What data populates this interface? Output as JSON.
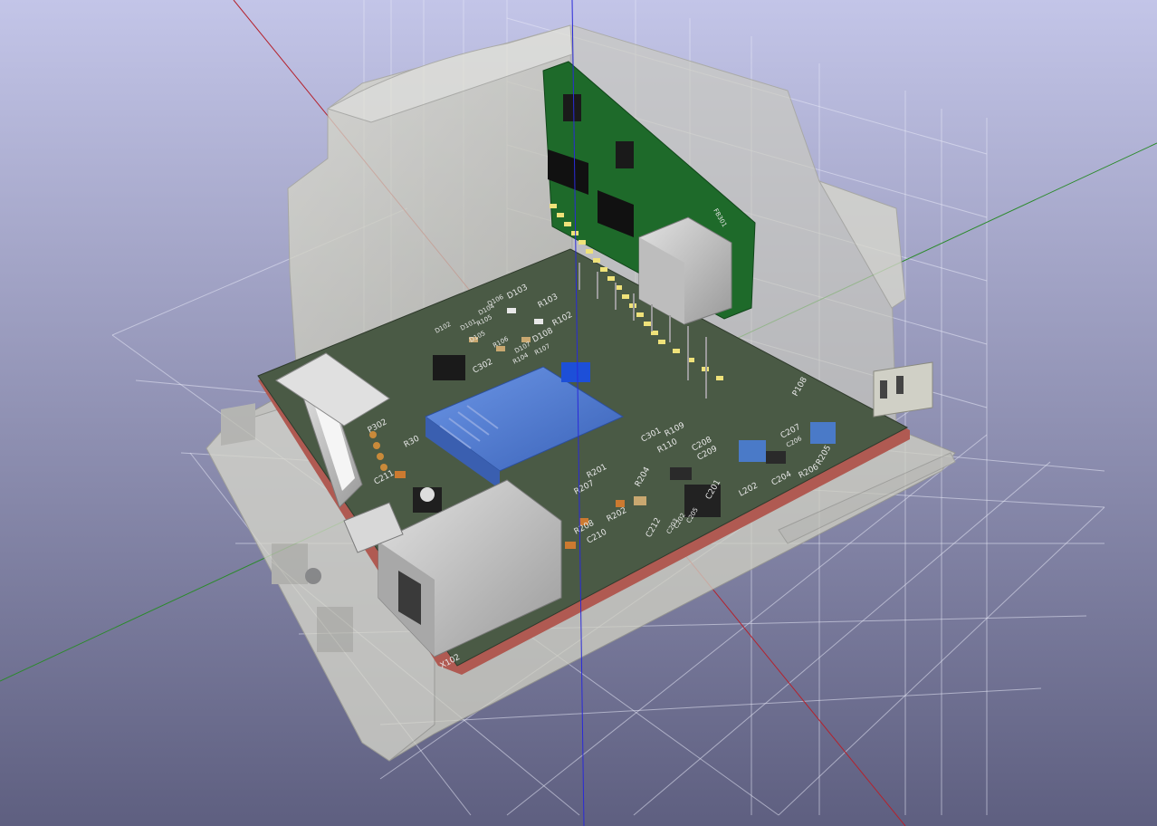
{
  "app": {
    "window_title": ""
  },
  "colors": {
    "background_top": "#c3c5e8",
    "background_bottom": "#5e5f80",
    "axis_x": "#b4222d",
    "axis_y": "#2b8a2b",
    "axis_z": "#2a2ad8",
    "pcb_main": "#4a5a45",
    "pcb_daughter": "#1e6a2a",
    "pcb_edge": "#b05a52",
    "enclosure": "#d2d2c4",
    "silkscreen": "#e8e8e8",
    "connector_blue": "#4a78d0",
    "metal": "#c4c4c4"
  },
  "silkscreen": {
    "x102": "X102",
    "p302": "P302",
    "c211": "C211",
    "r30": "R30",
    "d103": "D103",
    "r103": "R103",
    "r102": "R102",
    "d108": "D108",
    "d101": "D101",
    "d102": "D102",
    "d104": "D104",
    "d105": "D105",
    "d106": "D106",
    "d107": "D107",
    "r104": "R104",
    "r105": "R105",
    "r106": "R106",
    "r107": "R107",
    "c302": "C302",
    "r109": "R109",
    "r110": "R110",
    "c301": "C301",
    "r201": "R201",
    "r207": "R207",
    "r202": "R202",
    "r208": "R208",
    "c210": "C210",
    "c212": "C212",
    "r204": "R204",
    "c201": "C201",
    "c202": "C202",
    "c203": "C203",
    "c204": "C204",
    "c205": "C205",
    "c206": "C206",
    "c208": "C208",
    "c209": "C209",
    "l202": "L202",
    "r205": "R205",
    "r206": "R206",
    "p108": "P108",
    "fb301": "FB301",
    "c207": "C207"
  }
}
